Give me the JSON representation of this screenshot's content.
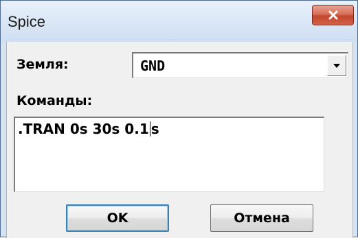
{
  "window": {
    "title": "Spice",
    "close_icon": "close-x-icon"
  },
  "form": {
    "ground_label": "Земля:",
    "ground_value": "GND",
    "ground_dropdown_icon": "chevron-down-icon",
    "commands_label": "Команды:",
    "commands_before_caret": ".TRAN 0s 30s 0.1",
    "commands_after_caret": "s"
  },
  "buttons": {
    "ok_label": "OK",
    "cancel_label": "Отмена"
  },
  "colors": {
    "title_bar": "#d9e6f5",
    "close_button": "#c4452d",
    "dialog_face": "#f0f0f0",
    "default_button_border": "#3c7fb1"
  }
}
